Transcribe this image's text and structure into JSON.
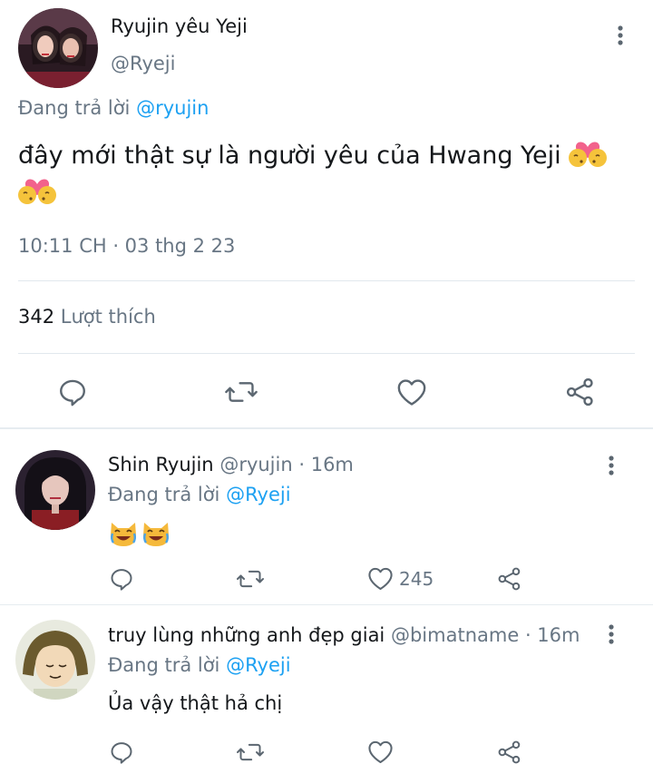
{
  "main_tweet": {
    "display_name": "Ryujin yêu Yeji",
    "handle": "@Ryeji",
    "reply_prefix": "Đang trả lời",
    "reply_to": "@ryujin",
    "text": "đây mới thật sự là người yêu của Hwang Yeji",
    "emoji_names": [
      "kissing-couple-emoji",
      "kissing-couple-emoji"
    ],
    "timestamp": "10:11 CH · 03 thg 2 23",
    "like_count": "342",
    "like_label": "Lượt thích",
    "actions": [
      "reply-icon",
      "retweet-icon",
      "heart-icon",
      "share-icon"
    ]
  },
  "replies": [
    {
      "display_name": "Shin Ryujin",
      "handle": "@ryujin",
      "time": "· 16m",
      "reply_prefix": "Đang trả lời",
      "reply_to": "@Ryeji",
      "emoji_names": [
        "grinning-cat-emoji",
        "grinning-cat-emoji"
      ],
      "like_count": "245"
    },
    {
      "display_name": "truy lùng những anh đẹp giai",
      "handle": "@bimatname",
      "time": "· 16m",
      "reply_prefix": "Đang trả lời",
      "reply_to": "@Ryeji",
      "text": "Ủa vậy thật hả chị",
      "like_count": ""
    }
  ],
  "colors": {
    "text": "#14171a",
    "secondary": "#687684",
    "link": "#1da1f2",
    "divider": "#e1e8ed"
  }
}
